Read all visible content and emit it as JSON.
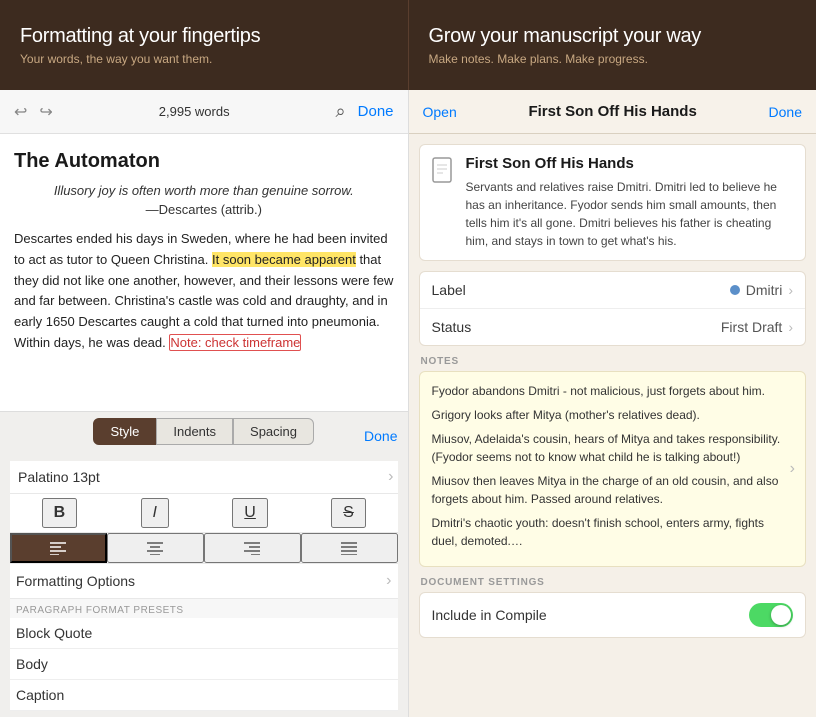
{
  "banners": {
    "left": {
      "title": "Formatting at your fingertips",
      "subtitle": "Your words, the way you want them."
    },
    "right": {
      "title": "Grow your manuscript your way",
      "subtitle": "Make notes. Make plans. Make progress."
    }
  },
  "left_panel": {
    "nav": {
      "word_count": "2,995 words",
      "done_label": "Done"
    },
    "editor": {
      "title": "The Automaton",
      "quote": "Illusory joy is often worth more than genuine sorrow.",
      "attribution": "—Descartes (attrib.)",
      "body_parts": [
        "Descartes ended his days in Sweden, where he had been invited to act as tutor to Queen Christina. ",
        "It soon became apparent",
        " that they did not like one another, however, and their lessons were few and far between. Christina's castle was cold and draughty, and in early 1650 Descartes caught a cold that turned into pneumonia. Within days, he was dead. ",
        "Note: check timeframe"
      ]
    },
    "format_toolbar": {
      "tab_style": "Style",
      "tab_indents": "Indents",
      "tab_spacing": "Spacing",
      "done_label": "Done",
      "font_label": "Palatino 13pt",
      "bold": "B",
      "italic": "I",
      "underline": "U",
      "strikethrough": "S",
      "align_left": "≡",
      "align_center": "≡",
      "align_right": "≡",
      "align_justify": "≡",
      "formatting_options": "Formatting Options",
      "presets_label": "PARAGRAPH FORMAT PRESETS",
      "presets": [
        "Block Quote",
        "Body",
        "Caption"
      ]
    }
  },
  "right_panel": {
    "nav": {
      "open_label": "Open",
      "title": "First Son Off His Hands",
      "done_label": "Done"
    },
    "doc": {
      "title": "First Son Off His Hands",
      "synopsis": "Servants and relatives raise Dmitri. Dmitri led to believe he has an inheritance. Fyodor sends him small amounts, then tells him it's all gone. Dmitri believes his father is cheating him, and stays in town to get what's his."
    },
    "meta": {
      "label_field": "Label",
      "label_value": "Dmitri",
      "status_field": "Status",
      "status_value": "First Draft"
    },
    "notes": {
      "header": "NOTES",
      "items": [
        "Fyodor abandons Dmitri - not malicious, just forgets about him.",
        "Grigory looks after Mitya (mother's relatives dead).",
        "Miusov, Adelaida's cousin, hears of Mitya and takes responsibility. (Fyodor seems not to know what child he is talking about!)",
        "Miusov then leaves Mitya in the charge of an old cousin, and also forgets about him. Passed around relatives.",
        "Dmitri's chaotic youth: doesn't finish school, enters army, fights duel, demoted.…"
      ]
    },
    "settings": {
      "header": "DOCUMENT SETTINGS",
      "include_compile": "Include in Compile"
    }
  }
}
